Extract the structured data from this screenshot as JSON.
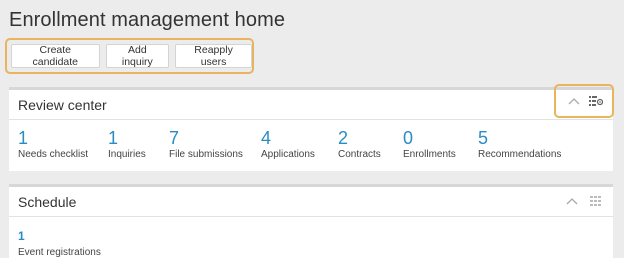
{
  "page": {
    "title": "Enrollment management home"
  },
  "toolbar": {
    "buttons": [
      "Create candidate",
      "Add inquiry",
      "Reapply users"
    ]
  },
  "review_center": {
    "title": "Review center",
    "stats": [
      {
        "value": "1",
        "label": "Needs checklist"
      },
      {
        "value": "1",
        "label": "Inquiries"
      },
      {
        "value": "7",
        "label": "File submissions"
      },
      {
        "value": "4",
        "label": "Applications"
      },
      {
        "value": "2",
        "label": "Contracts"
      },
      {
        "value": "0",
        "label": "Enrollments"
      },
      {
        "value": "5",
        "label": "Recommendations"
      }
    ]
  },
  "schedule": {
    "title": "Schedule",
    "item": {
      "value": "1",
      "label": "Event registrations"
    }
  },
  "colors": {
    "accent": "#2a8cc4",
    "highlight": "#e8b460",
    "background": "#ececec"
  },
  "icons": [
    "chevron-up-icon",
    "settings-grid-icon"
  ]
}
